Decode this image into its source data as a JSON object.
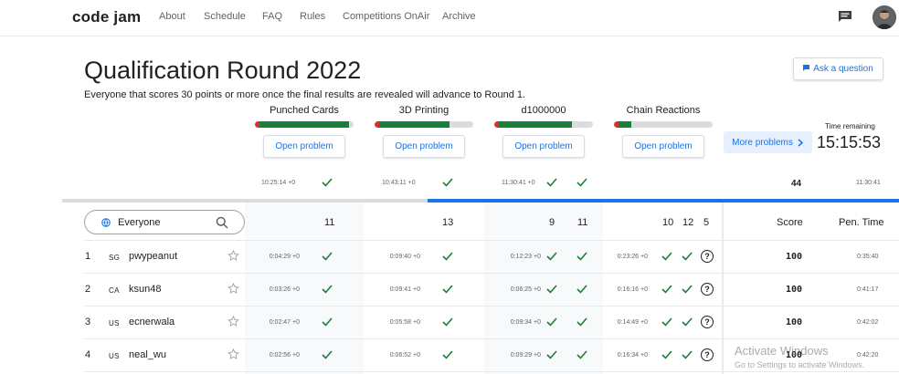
{
  "nav": {
    "logo": "code jam",
    "items": [
      "About",
      "Schedule",
      "FAQ",
      "Rules",
      "Competitions OnAir",
      "Archive"
    ]
  },
  "page": {
    "title": "Qualification Round 2022",
    "subtitle": "Everyone that scores 30 points or more once the final results are revealed will advance to Round 1.",
    "ask_button": "Ask a question",
    "more_problems": "More problems",
    "time_label": "Time remaining",
    "time_value": "15:15:53"
  },
  "problems": [
    {
      "name": "Punched Cards",
      "open": "Open problem",
      "solved_frac": 0.95
    },
    {
      "name": "3D Printing",
      "open": "Open problem",
      "solved_frac": 0.75
    },
    {
      "name": "d1000000",
      "open": "Open problem",
      "solved_frac": 0.78
    },
    {
      "name": "Chain Reactions",
      "open": "Open problem",
      "solved_frac": 0.14
    }
  ],
  "own_row": {
    "times": [
      "10:25:14 +0",
      "10:43:11 +0",
      "11:30:41 +0"
    ],
    "score": "44",
    "penalty": "11:30:41"
  },
  "table": {
    "search_placeholder": "Everyone",
    "header_points": [
      "11",
      "13",
      "9",
      "11",
      "10",
      "12",
      "5"
    ],
    "score_header": "Score",
    "penalty_header": "Pen. Time",
    "rows": [
      {
        "rank": "1",
        "country": "SG",
        "name": "pwypeanut",
        "times": [
          "0:04:29 +0",
          "0:09:40 +0",
          "0:12:23 +0",
          "0:23:26 +0"
        ],
        "score": "100",
        "penalty": "0:35:40"
      },
      {
        "rank": "2",
        "country": "CA",
        "name": "ksun48",
        "times": [
          "0:03:26 +0",
          "0:09:41 +0",
          "0:06:25 +0",
          "0:16:16 +0"
        ],
        "score": "100",
        "penalty": "0:41:17"
      },
      {
        "rank": "3",
        "country": "US",
        "name": "ecnerwala",
        "times": [
          "0:02:47 +0",
          "0:05:58 +0",
          "0:09:34 +0",
          "0:14:49 +0"
        ],
        "score": "100",
        "penalty": "0:42:02"
      },
      {
        "rank": "4",
        "country": "US",
        "name": "neal_wu",
        "times": [
          "0:02:56 +0",
          "0:06:52 +0",
          "0:09:29 +0",
          "0:16:34 +0"
        ],
        "score": "100",
        "penalty": "0:42:20"
      }
    ]
  },
  "watermark": {
    "line1": "Activate Windows",
    "line2": "Go to Settings to activate Windows."
  },
  "colors": {
    "accent": "#1a73e8",
    "success": "#188038",
    "error": "#d93025"
  }
}
